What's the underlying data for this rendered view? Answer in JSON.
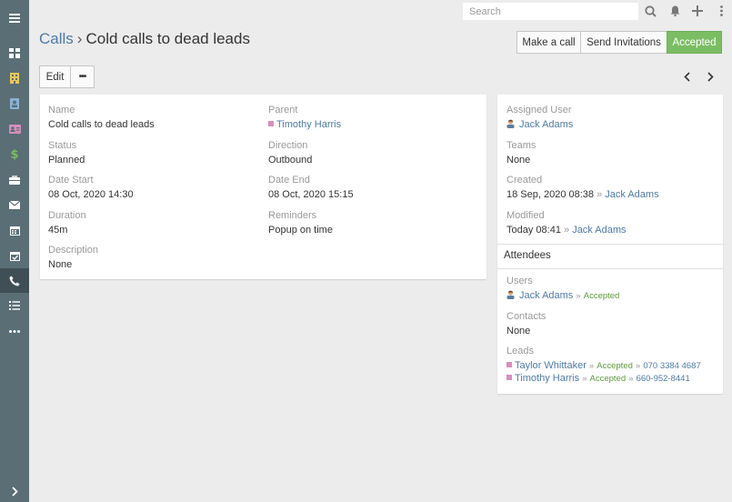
{
  "topbar": {
    "search_placeholder": "Search",
    "icons": [
      "search-icon",
      "bell-icon",
      "plus-icon",
      "kebab-icon"
    ]
  },
  "sidebar": {
    "items": [
      {
        "name": "menu-icon"
      },
      {
        "name": "dashboard-icon"
      },
      {
        "name": "accounts-icon"
      },
      {
        "name": "contacts-icon"
      },
      {
        "name": "leads-icon"
      },
      {
        "name": "opportunities-icon"
      },
      {
        "name": "cases-icon"
      },
      {
        "name": "emails-icon"
      },
      {
        "name": "calendar-icon"
      },
      {
        "name": "meetings-icon"
      },
      {
        "name": "calls-icon",
        "active": true
      },
      {
        "name": "tasks-icon"
      },
      {
        "name": "more-icon"
      },
      {
        "name": "expand-icon"
      }
    ]
  },
  "header": {
    "crumb_link": "Calls",
    "separator": "›",
    "title": "Cold calls to dead leads",
    "buttons": {
      "make_call": "Make a call",
      "send_invitations": "Send Invitations",
      "accepted": "Accepted"
    },
    "edit": "Edit",
    "more": "•••"
  },
  "main": {
    "name": {
      "label": "Name",
      "value": "Cold calls to dead leads"
    },
    "parent": {
      "label": "Parent",
      "value": "Timothy Harris"
    },
    "status": {
      "label": "Status",
      "value": "Planned"
    },
    "direction": {
      "label": "Direction",
      "value": "Outbound"
    },
    "date_start": {
      "label": "Date Start",
      "value": "08 Oct, 2020 14:30"
    },
    "date_end": {
      "label": "Date End",
      "value": "08 Oct, 2020 15:15"
    },
    "duration": {
      "label": "Duration",
      "value": "45m"
    },
    "reminders": {
      "label": "Reminders",
      "value": "Popup on time"
    },
    "description": {
      "label": "Description",
      "value": "None"
    }
  },
  "side": {
    "assigned_user": {
      "label": "Assigned User",
      "value": "Jack Adams"
    },
    "teams": {
      "label": "Teams",
      "value": "None"
    },
    "created": {
      "label": "Created",
      "date": "18 Sep, 2020 08:38",
      "sep": "»",
      "user": "Jack Adams"
    },
    "modified": {
      "label": "Modified",
      "date": "Today 08:41",
      "sep": "»",
      "user": "Jack Adams"
    }
  },
  "attendees": {
    "title": "Attendees",
    "users": {
      "label": "Users",
      "name": "Jack Adams",
      "sep": "»",
      "status": "Accepted"
    },
    "contacts": {
      "label": "Contacts",
      "value": "None"
    },
    "leads": {
      "label": "Leads",
      "items": [
        {
          "name": "Taylor Whittaker",
          "sep1": "»",
          "status": "Accepted",
          "sep2": "»",
          "phone": "070 3384 4687"
        },
        {
          "name": "Timothy Harris",
          "sep1": "»",
          "status": "Accepted",
          "sep2": "»",
          "phone": "660-952-8441"
        }
      ]
    }
  },
  "colors": {
    "sidebar": "#5a6e75",
    "sidebar_active": "#3f4f55",
    "link": "#4e7aa5",
    "success": "#7bbd63",
    "lead_square": "#d88ebc"
  }
}
